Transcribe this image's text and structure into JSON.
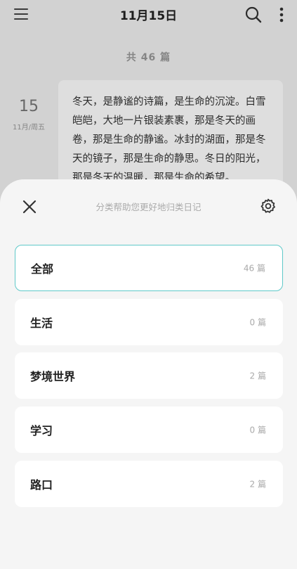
{
  "header": {
    "title": "11月15日"
  },
  "summary": {
    "count_text": "共 46 篇"
  },
  "entry": {
    "day": "15",
    "date_sub": "11月/周五",
    "text": "冬天，是静谧的诗篇，是生命的沉淀。白雪皑皑，大地一片银装素裹，那是冬天的画卷，那是生命的静谧。冰封的湖面，那是冬天的镜子，那是生命的静思。冬日的阳光，那是冬天的温暖，那是生命的希望。"
  },
  "sheet": {
    "title": "分类帮助您更好地归类日记",
    "categories": [
      {
        "name": "全部",
        "count": "46 篇"
      },
      {
        "name": "生活",
        "count": "0 篇"
      },
      {
        "name": "梦境世界",
        "count": "2 篇"
      },
      {
        "name": "学习",
        "count": "0 篇"
      },
      {
        "name": "路口",
        "count": "2 篇"
      }
    ]
  },
  "colors": {
    "accent": "#5fc9c9",
    "sheet_bg": "#f5f5f5"
  },
  "icons": [
    "menu-icon",
    "search-icon",
    "more-icon",
    "close-icon",
    "settings-icon"
  ]
}
